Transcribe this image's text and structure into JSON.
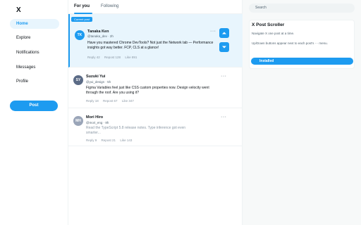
{
  "app": {
    "logo": "X"
  },
  "sidebar": {
    "items": [
      {
        "label": "Home"
      },
      {
        "label": "Explore"
      },
      {
        "label": "Notifications"
      },
      {
        "label": "Messages"
      },
      {
        "label": "Profile"
      }
    ],
    "post_label": "Post"
  },
  "feed": {
    "tabs": [
      {
        "label": "For you"
      },
      {
        "label": "Following"
      }
    ],
    "current_badge": "Current post",
    "posts": [
      {
        "initials": "TK",
        "avatar_color": "#1d9bf0",
        "name": "Tanaka Ken",
        "handle": "@tanaka_dev · 2h",
        "text": "Have you mastered Chrome DevTools? Not just the Network tab — Performance insights got way better. FCP, CLS at a glance!",
        "replies": "Reply 42",
        "reposts": "Repost 128",
        "likes": "Like 891"
      },
      {
        "initials": "SY",
        "avatar_color": "#5b6b86",
        "name": "Suzuki Yui",
        "handle": "@yui_design · 5h",
        "text": "Figma Variables feel just like CSS custom properties now. Design velocity went through the roof. Are you using it?",
        "replies": "Reply 18",
        "reposts": "Repost 67",
        "likes": "Like 347"
      },
      {
        "initials": "MH",
        "avatar_color": "#9aa5b8",
        "name": "Mori Hiro",
        "handle": "@mori_eng · 8h",
        "text": "Read the TypeScript 5.8 release notes. Type inference got even smarter...",
        "replies": "Reply 9",
        "reposts": "Repost 21",
        "likes": "Like 143"
      }
    ]
  },
  "right": {
    "search_placeholder": "Search",
    "card": {
      "title": "X Post Scroller",
      "line1": "Navigate X one post at a time.",
      "line2": "Up/Down buttons appear next to each post's ··· menu.",
      "installed_label": "Installed"
    }
  },
  "colors": {
    "accent": "#1d9bf0",
    "highlight_bg": "#e8f5fd"
  },
  "icons": {
    "more": "more-horizontal-icon",
    "up": "chevron-up-icon",
    "down": "chevron-down-icon"
  }
}
